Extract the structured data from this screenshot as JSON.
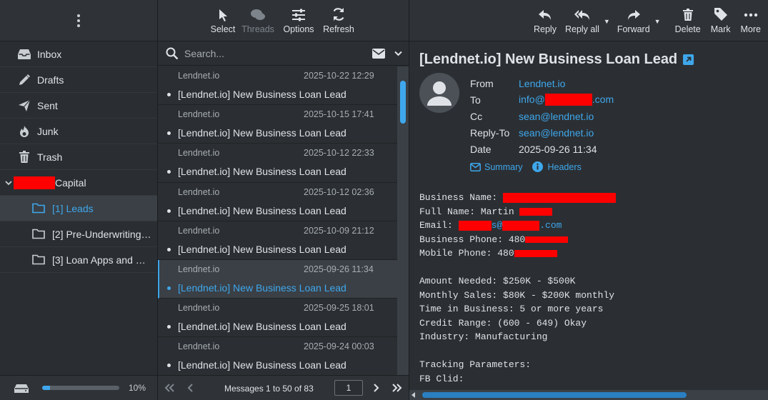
{
  "folders": [
    {
      "label": "Inbox",
      "icon": "inbox-icon"
    },
    {
      "label": "Drafts",
      "icon": "pencil-icon"
    },
    {
      "label": "Sent",
      "icon": "send-icon"
    },
    {
      "label": "Junk",
      "icon": "fire-icon"
    },
    {
      "label": "Trash",
      "icon": "trash-icon"
    }
  ],
  "account": {
    "label": "Capital"
  },
  "subfolders": [
    {
      "label": "[1] Leads",
      "active": true
    },
    {
      "label": "[2] Pre-Underwriting ...",
      "active": false
    },
    {
      "label": "[3] Loan Apps and St...",
      "active": false
    }
  ],
  "quota": {
    "percent_text": "10%",
    "fraction": 0.1
  },
  "list_toolbar": {
    "select": "Select",
    "threads": "Threads",
    "options": "Options",
    "refresh": "Refresh"
  },
  "search": {
    "placeholder": "Search..."
  },
  "messages": [
    {
      "from": "Lendnet.io",
      "date": "2025-10-22 12:29",
      "subject": "[Lendnet.io] New Business Loan Lead"
    },
    {
      "from": "Lendnet.io",
      "date": "2025-10-15 17:41",
      "subject": "[Lendnet.io] New Business Loan Lead"
    },
    {
      "from": "Lendnet.io",
      "date": "2025-10-12 22:33",
      "subject": "[Lendnet.io] New Business Loan Lead"
    },
    {
      "from": "Lendnet.io",
      "date": "2025-10-12 02:36",
      "subject": "[Lendnet.io] New Business Loan Lead"
    },
    {
      "from": "Lendnet.io",
      "date": "2025-10-09 21:12",
      "subject": "[Lendnet.io] New Business Loan Lead"
    },
    {
      "from": "Lendnet.io",
      "date": "2025-09-26 11:34",
      "subject": "[Lendnet.io] New Business Loan Lead"
    },
    {
      "from": "Lendnet.io",
      "date": "2025-09-25 18:01",
      "subject": "[Lendnet.io] New Business Loan Lead"
    },
    {
      "from": "Lendnet.io",
      "date": "2025-09-24 00:03",
      "subject": "[Lendnet.io] New Business Loan Lead"
    }
  ],
  "pager": {
    "text": "Messages 1 to 50 of 83",
    "page": "1"
  },
  "msg_toolbar": {
    "reply": "Reply",
    "reply_all": "Reply all",
    "forward": "Forward",
    "delete": "Delete",
    "mark": "Mark",
    "more": "More"
  },
  "message": {
    "subject": "[Lendnet.io] New Business Loan Lead",
    "headers": {
      "from_label": "From",
      "from": "Lendnet.io",
      "to_label": "To",
      "to_prefix": "info@",
      "to_suffix": ".com",
      "cc_label": "Cc",
      "cc": "sean@lendnet.io",
      "replyto_label": "Reply-To",
      "replyto": "sean@lendnet.io",
      "date_label": "Date",
      "date": "2025-09-26 11:34"
    },
    "summary_link": "Summary",
    "headers_link": "Headers",
    "body": {
      "business_name": "Business Name: ",
      "full_name": "Full Name: Martin ",
      "email_label": "Email: ",
      "email_mid": "s@",
      "email_end": ".com",
      "business_phone": "Business Phone: 480",
      "mobile_phone": "Mobile Phone: 480",
      "amount": "Amount Needed: $250K - $500K",
      "sales": "Monthly Sales: $80K - $200K monthly",
      "time": "Time in Business: 5 or more years",
      "credit": "Credit Range: (600 - 649) Okay",
      "industry": "Industry: Manufacturing",
      "tracking": "Tracking Parameters:",
      "fbclid": "FB Clid:"
    }
  },
  "colors": {
    "accent": "#3fa7ec",
    "redaction": "#ff0000"
  }
}
